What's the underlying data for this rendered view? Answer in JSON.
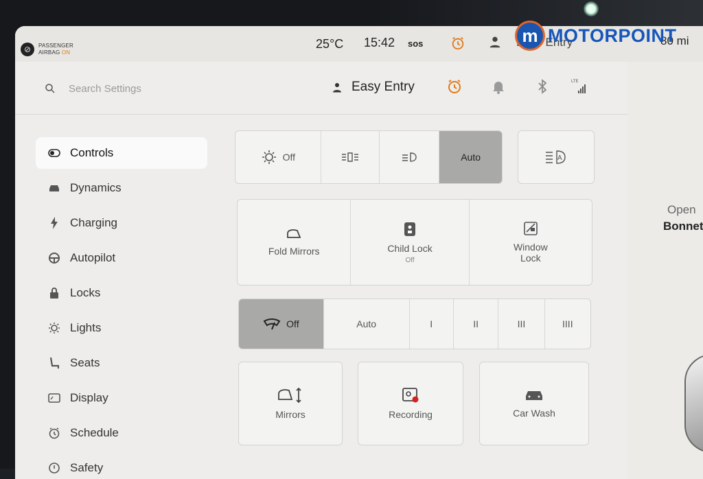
{
  "status_bar": {
    "airbag_line1": "PASSENGER",
    "airbag_line2": "AIRBAG",
    "airbag_state": "ON",
    "temperature": "25°C",
    "time": "15:42",
    "sos": "sos",
    "profile": "Easy Entry",
    "range": "80 mi"
  },
  "watermark": {
    "badge": "m",
    "text": "MOTORPOINT"
  },
  "topbar": {
    "search_placeholder": "Search Settings",
    "profile_name": "Easy Entry"
  },
  "sidebar": {
    "items": [
      {
        "label": "Controls",
        "icon": "toggle-icon",
        "active": true
      },
      {
        "label": "Dynamics",
        "icon": "car-icon"
      },
      {
        "label": "Charging",
        "icon": "bolt-icon"
      },
      {
        "label": "Autopilot",
        "icon": "steering-wheel-icon"
      },
      {
        "label": "Locks",
        "icon": "lock-icon"
      },
      {
        "label": "Lights",
        "icon": "sun-icon"
      },
      {
        "label": "Seats",
        "icon": "seat-icon"
      },
      {
        "label": "Display",
        "icon": "display-icon"
      },
      {
        "label": "Schedule",
        "icon": "clock-icon"
      },
      {
        "label": "Safety",
        "icon": "safety-icon"
      }
    ]
  },
  "lights": {
    "off_label": "Off",
    "auto_label": "Auto",
    "selected": "Auto"
  },
  "controls": {
    "fold_mirrors": "Fold Mirrors",
    "child_lock": "Child Lock",
    "child_lock_state": "Off",
    "window_lock_1": "Window",
    "window_lock_2": "Lock"
  },
  "wipers": {
    "off_label": "Off",
    "auto_label": "Auto",
    "speed1": "I",
    "speed2": "II",
    "speed3": "III",
    "speed4": "IIII",
    "selected": "Off"
  },
  "shortcuts": {
    "mirrors": "Mirrors",
    "recording": "Recording",
    "car_wash": "Car Wash"
  },
  "right_panel": {
    "open": "Open",
    "bonnet": "Bonnet"
  },
  "colors": {
    "accent_orange": "#e07a18",
    "record_red": "#d62020",
    "logo_blue": "#1656b9"
  }
}
